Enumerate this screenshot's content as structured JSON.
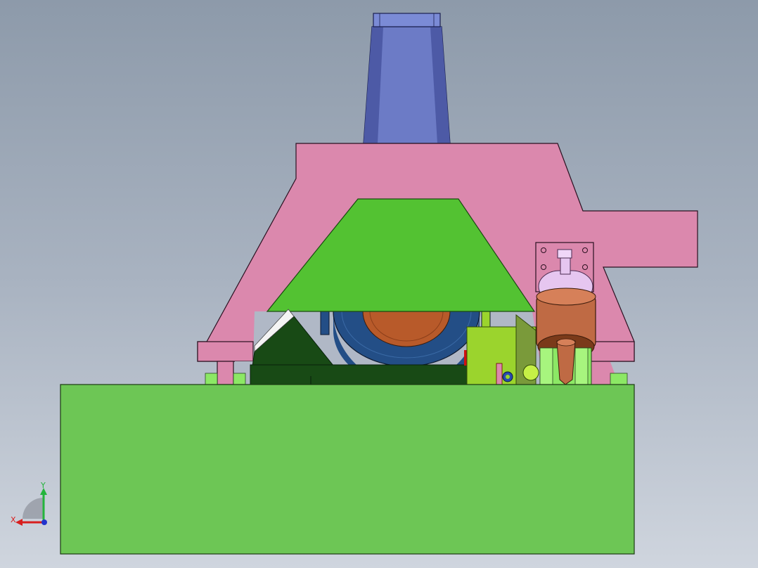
{
  "viewport": {
    "background_top": "#8d9aaa",
    "background_bottom": "#cfd5de"
  },
  "model": {
    "parts": [
      {
        "name": "base-block",
        "color": "#6dc655"
      },
      {
        "name": "main-frame",
        "color": "#db88ad"
      },
      {
        "name": "hopper-cover",
        "color": "#53c232"
      },
      {
        "name": "motor-column",
        "color": "#6c7bc6"
      },
      {
        "name": "drive-wheel",
        "color": "#234e86"
      },
      {
        "name": "drive-hub",
        "color": "#b85a2a"
      },
      {
        "name": "support-bracket",
        "color": "#184a15"
      },
      {
        "name": "gearbox",
        "color": "#9bd42d"
      },
      {
        "name": "cylinder-body",
        "color": "#e6c6f0"
      },
      {
        "name": "cylinder-rod",
        "color": "#bf6a44"
      }
    ]
  },
  "triad": {
    "x_label": "X",
    "y_label": "Y",
    "x_color": "#d81e1e",
    "y_color": "#24b43c",
    "z_color": "#2233cc"
  }
}
